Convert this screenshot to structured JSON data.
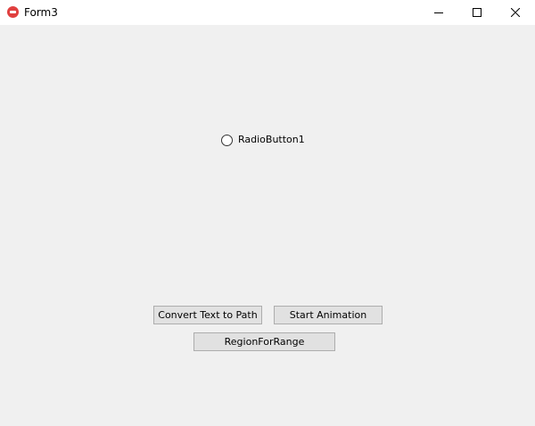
{
  "window": {
    "title": "Form3",
    "icon": "app-logo-icon",
    "controls": {
      "minimize": "minimize-icon",
      "maximize": "maximize-icon",
      "close": "close-icon"
    }
  },
  "form": {
    "radio": {
      "label": "RadioButton1",
      "checked": false
    },
    "buttons": {
      "convert": "Convert Text to Path",
      "animation": "Start Animation",
      "region": "RegionForRange"
    }
  },
  "colors": {
    "form_background": "#f0f0f0",
    "titlebar_background": "#ffffff",
    "button_face": "#e1e1e1",
    "button_border": "#adadad",
    "app_icon": "#e0403f"
  }
}
